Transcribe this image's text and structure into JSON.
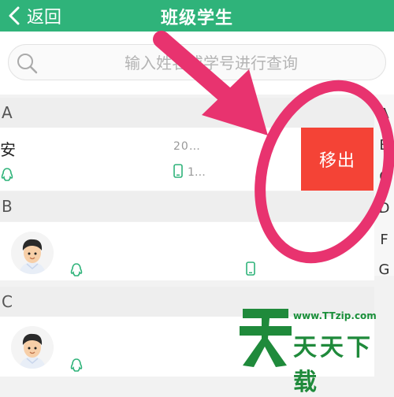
{
  "header": {
    "back_label": "返回",
    "title": "班级学生",
    "bg_color": "#2fb37a"
  },
  "search": {
    "placeholder": "输入姓名或学号进行查询",
    "value": ""
  },
  "sections": [
    {
      "letter": "A",
      "students": [
        {
          "name": "安",
          "student_id": "20…",
          "phone": "1…"
        }
      ]
    },
    {
      "letter": "B"
    },
    {
      "letter": "C"
    }
  ],
  "actions": {
    "remove_label": "移出",
    "remove_color": "#f44336"
  },
  "index_bar": [
    "A",
    "B",
    "C",
    "D",
    "F",
    "G"
  ],
  "annotation": {
    "arrow_color": "#e8336f",
    "circle_color": "#e8336f"
  },
  "watermark": {
    "url": "www.TTzip.com",
    "name": "天天下载",
    "logo_char": "天"
  },
  "icons": [
    "back-arrow-icon",
    "search-icon",
    "qq-icon",
    "phone-icon"
  ]
}
